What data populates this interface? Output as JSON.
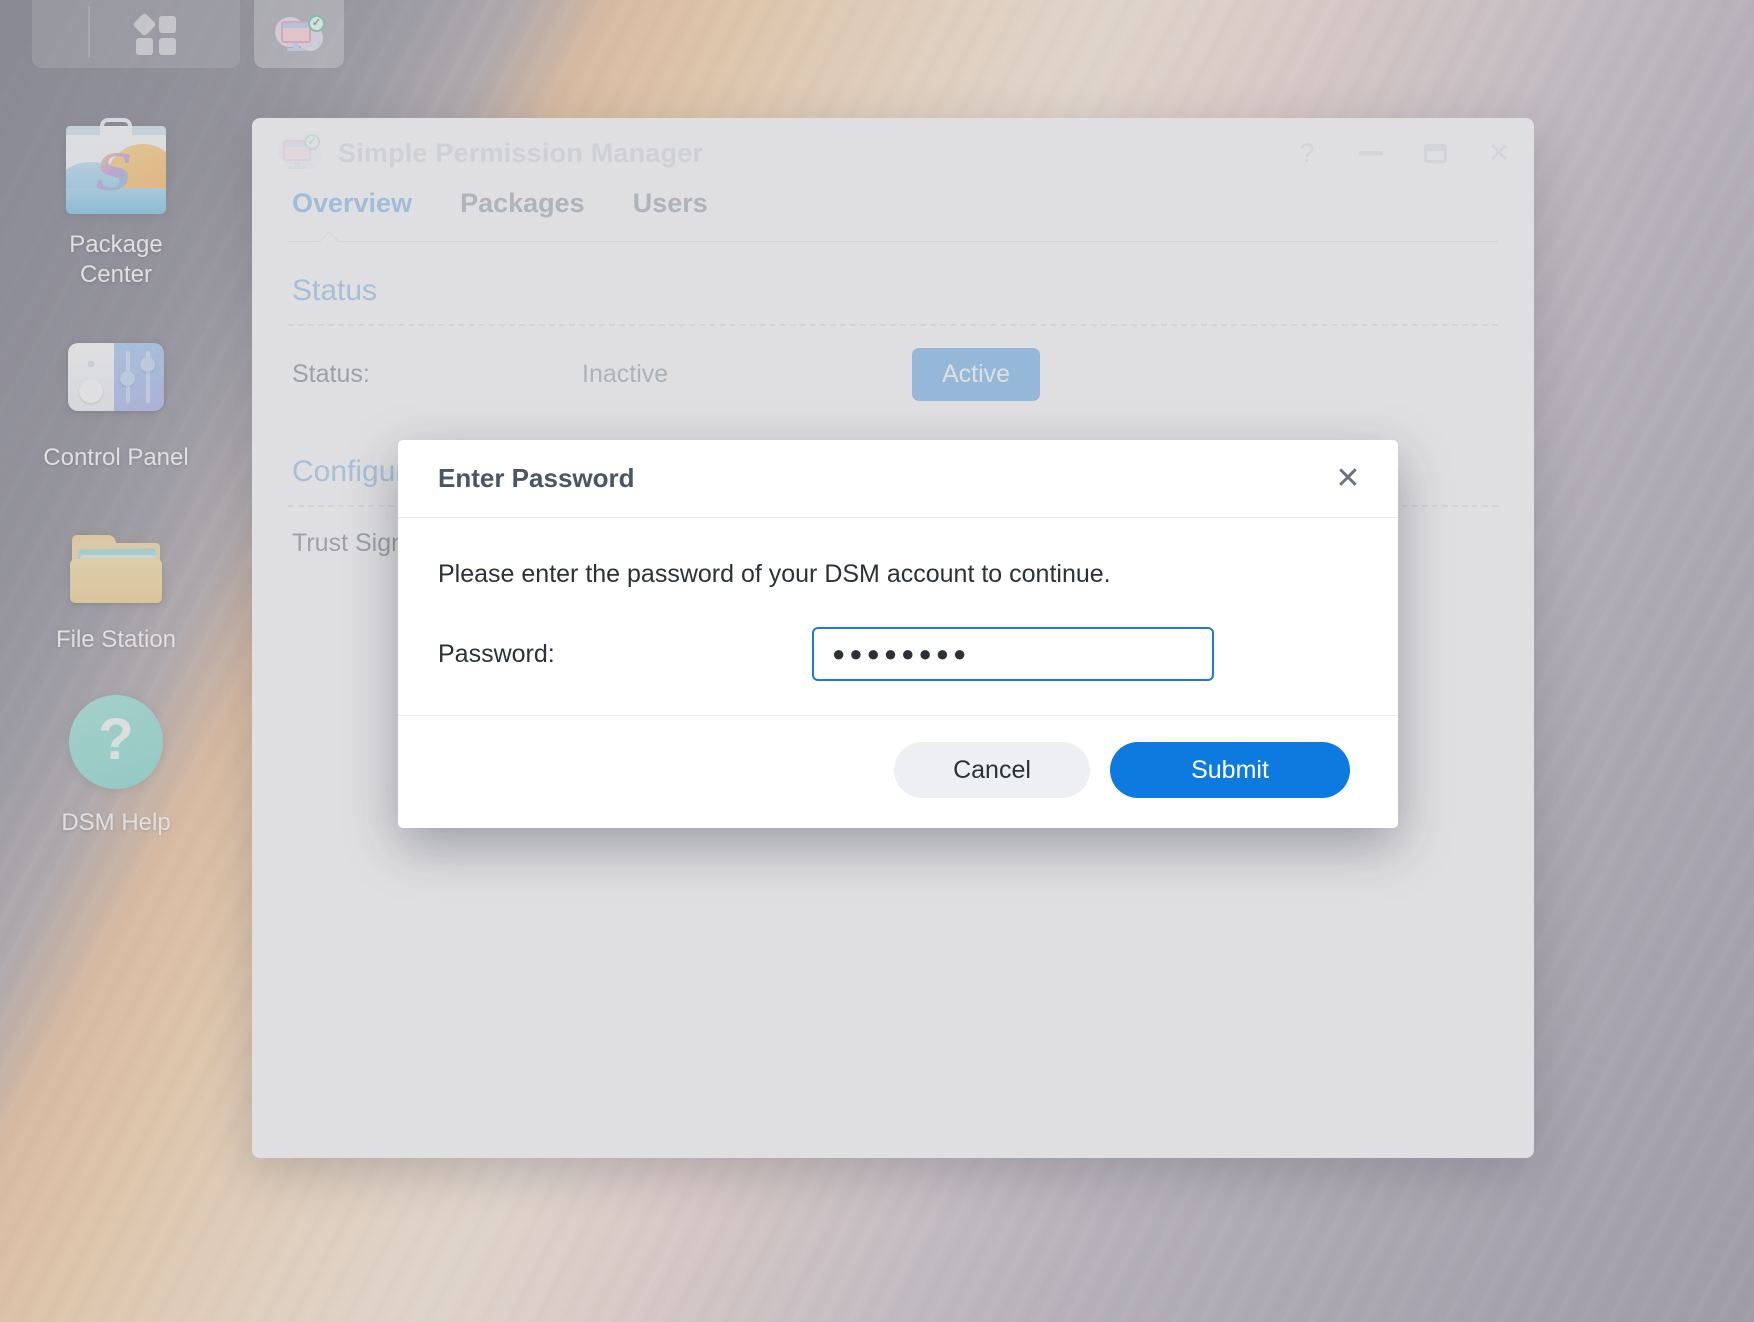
{
  "taskbar": {
    "apps_button": {
      "name": "Main Menu",
      "icon": "apps-grid-icon"
    },
    "items": [
      {
        "name": "Simple Permission Manager",
        "icon": "package-manager-icon",
        "active": true
      }
    ]
  },
  "desktop": {
    "icons": [
      {
        "label": "Package\nCenter",
        "line1": "Package",
        "line2": "Center",
        "icon": "package-center-icon"
      },
      {
        "label": "Control Panel",
        "line1": "Control Panel",
        "line2": "",
        "icon": "control-panel-icon"
      },
      {
        "label": "File Station",
        "line1": "File Station",
        "line2": "",
        "icon": "file-station-icon"
      },
      {
        "label": "DSM Help",
        "line1": "DSM Help",
        "line2": "",
        "icon": "dsm-help-icon"
      }
    ]
  },
  "window": {
    "title": "Simple Permission Manager",
    "icon": "package-manager-icon",
    "controls": {
      "help": "?",
      "minimize": "—",
      "maximize": "□",
      "close": "✕"
    },
    "tabs": [
      {
        "label": "Overview",
        "active": true
      },
      {
        "label": "Packages",
        "active": false
      },
      {
        "label": "Users",
        "active": false
      }
    ],
    "sections": [
      {
        "title": "Status",
        "rows": [
          {
            "label": "Status:",
            "value": "Inactive",
            "button": "Active"
          }
        ]
      },
      {
        "title": "Configuration",
        "rows": [
          {
            "label": "Trust Signature",
            "value": "",
            "button": ""
          }
        ]
      }
    ]
  },
  "modal": {
    "title": "Enter Password",
    "close_icon": "✕",
    "description": "Please enter the password of your DSM account to continue.",
    "password_label": "Password:",
    "password_value": "●●●●●●●●",
    "password_placeholder": "",
    "cancel_label": "Cancel",
    "submit_label": "Submit"
  },
  "colors": {
    "accent_blue": "#0d7ae0",
    "tab_active": "#9ecbf5",
    "section_title": "#a9cff3",
    "active_button": "#8fc4f2",
    "focus_border": "#1a7ae0",
    "help_teal": "#8fded3"
  }
}
